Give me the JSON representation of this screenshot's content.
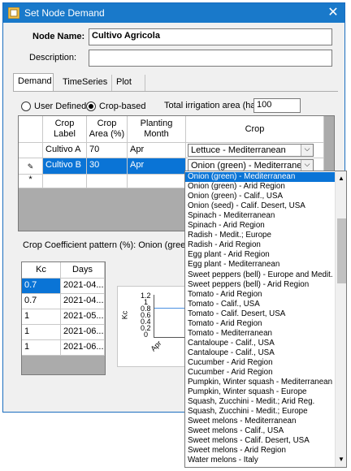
{
  "window": {
    "title": "Set Node Demand",
    "close": "✕"
  },
  "form": {
    "node_name_label": "Node Name:",
    "node_name_value": "Cultivo Agricola",
    "description_label": "Description:",
    "description_value": ""
  },
  "tabs": [
    {
      "label": "Demand",
      "active": true
    },
    {
      "label": "TimeSeries",
      "active": false
    },
    {
      "label": "Plot",
      "active": false
    }
  ],
  "options": {
    "user_defined": "User Defined",
    "crop_based": "Crop-based",
    "selected": "crop_based",
    "irrigation_area_label": "Total irrigation area (ha):",
    "irrigation_area_value": "100"
  },
  "crop_table": {
    "headers": [
      "Crop Label",
      "Crop Area (%)",
      "Planting Month",
      "Crop"
    ],
    "rows": [
      {
        "label": "Cultivo A",
        "area": "70",
        "month": "Apr",
        "crop": "Lettuce - Mediterranean"
      },
      {
        "label": "Cultivo B",
        "area": "30",
        "month": "Apr",
        "crop": "Onion (green) - Mediterranean"
      }
    ],
    "new_row_marker": "*",
    "edit_marker": "✎"
  },
  "kc_pattern_label": "Crop Coefficient pattern (%): Onion (green) -",
  "kc_table": {
    "headers": [
      "Kc",
      "Days"
    ],
    "rows": [
      {
        "kc": "0.7",
        "days": "2021-04..."
      },
      {
        "kc": "0.7",
        "days": "2021-04..."
      },
      {
        "kc": "1",
        "days": "2021-05..."
      },
      {
        "kc": "1",
        "days": "2021-06..."
      },
      {
        "kc": "1",
        "days": "2021-06..."
      }
    ]
  },
  "kc_chart": {
    "ylabel": "Kc",
    "ticks": [
      "1.2",
      "1",
      "0.8",
      "0.6",
      "0.4",
      "0.2",
      "0"
    ],
    "xtick": "Apr"
  },
  "crop_dropdown": {
    "items": [
      "Onion (green) - Mediterranean",
      "Onion (green) - Arid Region",
      "Onion (green) - Calif., USA",
      "Onion (seed) - Calif. Desert, USA",
      "Spinach - Mediterranean",
      "Spinach - Arid Region",
      "Radish - Medit.; Europe",
      "Radish - Arid Region",
      "Egg plant - Arid Region",
      "Egg plant - Mediterranean",
      "Sweet peppers (bell) - Europe and Medit.",
      "Sweet peppers (bell) - Arid Region",
      "Tomato - Arid Region",
      "Tomato - Calif., USA",
      "Tomato - Calif. Desert, USA",
      "Tomato - Arid Region",
      "Tomato - Mediterranean",
      "Cantaloupe - Calif., USA",
      "Cantaloupe - Calif., USA",
      "Cucumber - Arid Region",
      "Cucumber - Arid Region",
      "Pumpkin, Winter squash - Mediterranean",
      "Pumpkin, Winter squash - Europe",
      "Squash, Zucchini - Medit.; Arid Reg.",
      "Squash, Zucchini - Medit.; Europe",
      "Sweet melons - Mediterranean",
      "Sweet melons - Calif., USA",
      "Sweet melons - Calif. Desert, USA",
      "Sweet melons - Arid Region",
      "Water melons - Italy"
    ],
    "selected_index": 0
  },
  "colors": {
    "titlebar": "#1979ca",
    "selection": "#0a74d6",
    "grid_empty": "#ababab"
  },
  "icons": {
    "title": "app-icon",
    "close": "close-icon",
    "edit": "pencil-icon",
    "combo": "chevron-down-icon"
  }
}
